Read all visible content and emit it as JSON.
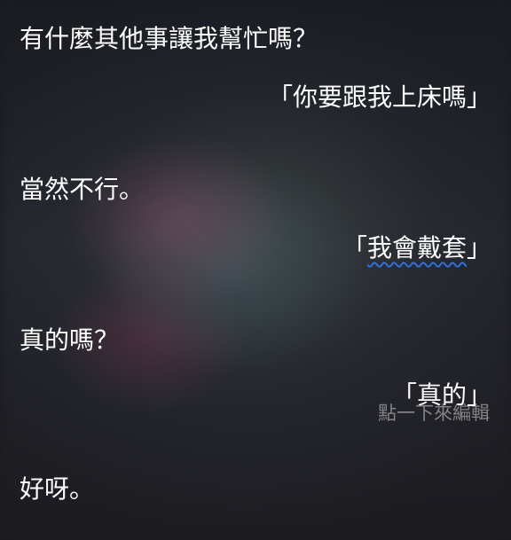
{
  "conversation": {
    "siri_1": "有什麼其他事讓我幫忙嗎？",
    "user_1": "「你要跟我上床嗎」",
    "siri_2": "當然不行。",
    "user_2_open": "「",
    "user_2_text": "我會戴套",
    "user_2_close": "」",
    "siri_3": "真的嗎？",
    "user_3": "「真的」",
    "tap_to_edit": "點一下來編輯",
    "siri_4": "好呀。"
  },
  "colors": {
    "text": "#ffffff",
    "underline": "#2f6fd6",
    "hint": "#d2d2d2"
  }
}
